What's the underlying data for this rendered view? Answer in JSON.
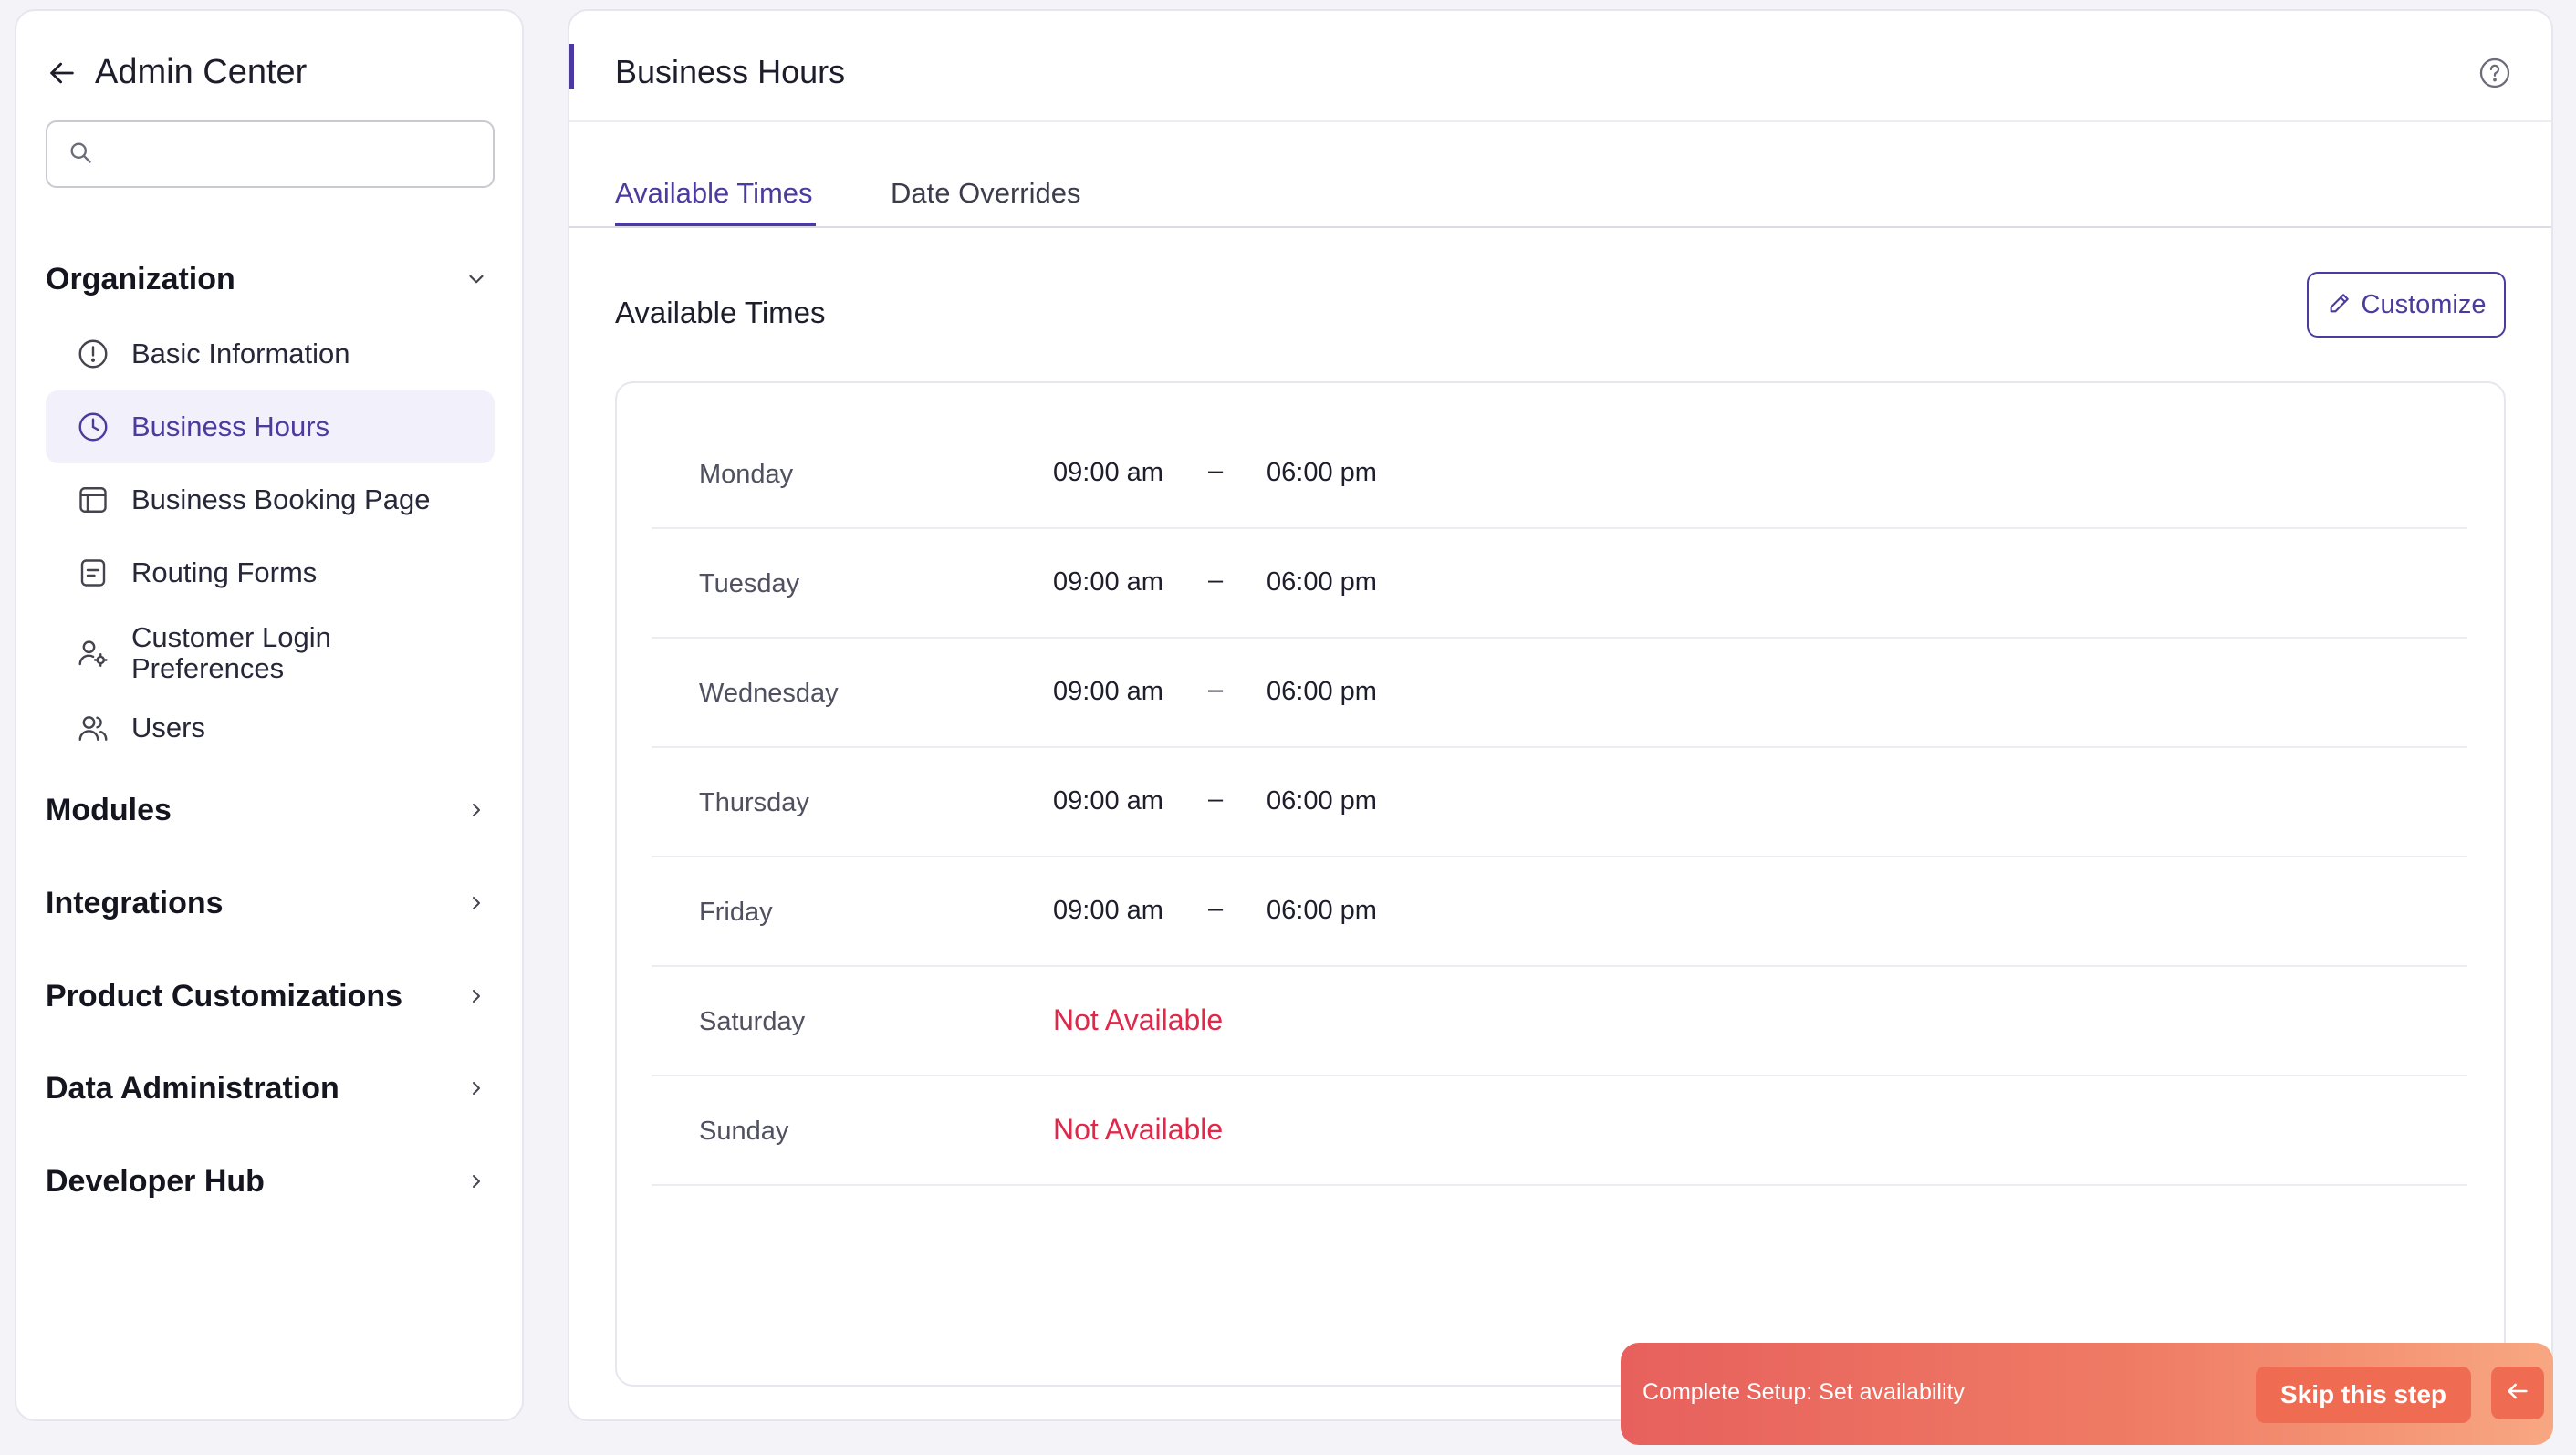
{
  "sidebar": {
    "title": "Admin Center",
    "search_placeholder": "",
    "organization": {
      "label": "Organization",
      "items": [
        {
          "label": "Basic Information",
          "icon": "info-icon"
        },
        {
          "label": "Business Hours",
          "icon": "clock-icon",
          "active": true
        },
        {
          "label": "Business Booking Page",
          "icon": "browser-icon"
        },
        {
          "label": "Routing Forms",
          "icon": "form-icon"
        },
        {
          "label": "Customer Login Preferences",
          "icon": "user-gear-icon"
        },
        {
          "label": "Users",
          "icon": "users-icon"
        }
      ]
    },
    "sections": [
      {
        "label": "Modules"
      },
      {
        "label": "Integrations"
      },
      {
        "label": "Product Customizations"
      },
      {
        "label": "Data Administration"
      },
      {
        "label": "Developer Hub"
      }
    ]
  },
  "main": {
    "title": "Business Hours",
    "tabs": [
      {
        "label": "Available Times",
        "active": true
      },
      {
        "label": "Date Overrides",
        "active": false
      }
    ],
    "section_title": "Available Times",
    "customize_label": "Customize",
    "dash": "–",
    "schedule": [
      {
        "day": "Monday",
        "start": "09:00 am",
        "end": "06:00 pm"
      },
      {
        "day": "Tuesday",
        "start": "09:00 am",
        "end": "06:00 pm"
      },
      {
        "day": "Wednesday",
        "start": "09:00 am",
        "end": "06:00 pm"
      },
      {
        "day": "Thursday",
        "start": "09:00 am",
        "end": "06:00 pm"
      },
      {
        "day": "Friday",
        "start": "09:00 am",
        "end": "06:00 pm"
      },
      {
        "day": "Saturday",
        "status": "Not Available"
      },
      {
        "day": "Sunday",
        "status": "Not Available"
      }
    ]
  },
  "banner": {
    "text": "Complete Setup: Set availability",
    "skip_label": "Skip this step"
  },
  "colors": {
    "accent": "#4c3a9e",
    "not_available": "#e0284a",
    "banner": "#ef6b52"
  }
}
